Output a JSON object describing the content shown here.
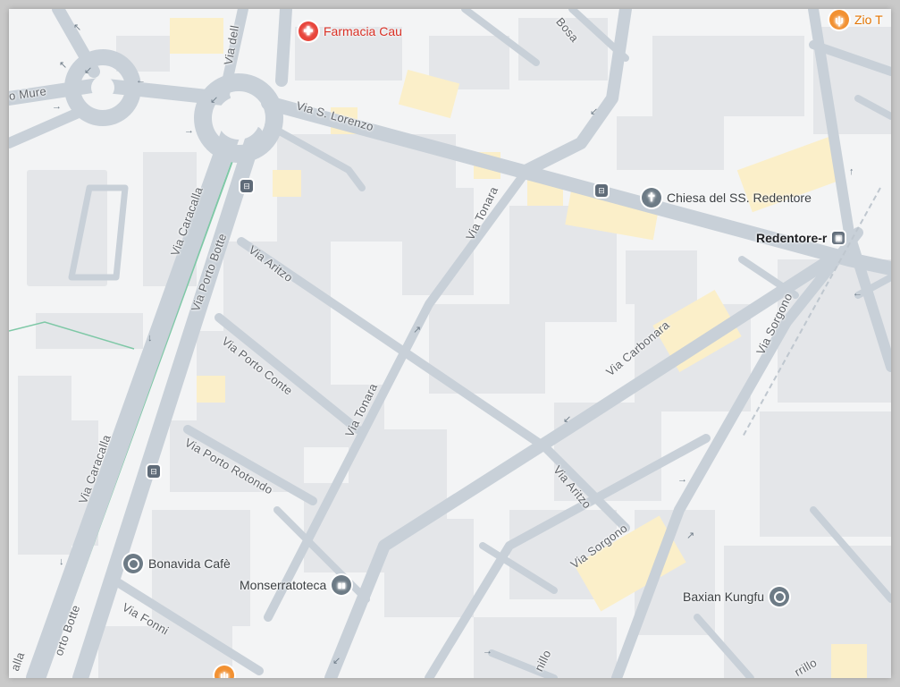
{
  "map": {
    "background": "#f3f4f5",
    "road_color": "#c8d0d8",
    "building_color": "#e4e6e9",
    "highlight_color": "#fbefc9",
    "park_path_color": "#7ec8a6"
  },
  "streets": [
    {
      "name": "Via S. Lorenzo"
    },
    {
      "name": "Via Caracalla"
    },
    {
      "name": "Via Caracalla"
    },
    {
      "name": "Via Porto Botte"
    },
    {
      "name": "Via Aritzo"
    },
    {
      "name": "Via Aritzo"
    },
    {
      "name": "Via Porto Conte"
    },
    {
      "name": "Via Tonara"
    },
    {
      "name": "Via Tonara"
    },
    {
      "name": "Via Porto Rotondo"
    },
    {
      "name": "Via Carbonara"
    },
    {
      "name": "Via Sorgono"
    },
    {
      "name": "Via Sorgono"
    },
    {
      "name": "Via Fonni"
    },
    {
      "name": "o Mure"
    },
    {
      "name": "Via dell"
    },
    {
      "name": "Bosa"
    },
    {
      "name": "orto Botte"
    },
    {
      "name": "alla"
    },
    {
      "name": "nillo"
    },
    {
      "name": "rrillo"
    }
  ],
  "pois": [
    {
      "name": "Farmacia Cau",
      "icon": "pharmacy-icon",
      "color": "#e8453c"
    },
    {
      "name": "Chiesa del SS. Redentore",
      "icon": "church-icon",
      "color": "#6d7b86"
    },
    {
      "name": "Redentore-r",
      "icon": "bus-stop-icon",
      "color": "#5b6f80"
    },
    {
      "name": "Bonavida Cafè",
      "icon": "place-icon",
      "color": "#6d7b86"
    },
    {
      "name": "Monserratoteca",
      "icon": "library-icon",
      "color": "#6d7b86"
    },
    {
      "name": "Baxian Kungfu",
      "icon": "place-icon",
      "color": "#6d7b86"
    },
    {
      "name": "Zio T",
      "icon": "restaurant-icon",
      "color": "#f29132"
    }
  ],
  "bus_symbol": "⊟",
  "pin_glyphs": {
    "pharmacy": "✚",
    "church": "✝",
    "library": "▮▮",
    "restaurant": "ψ",
    "bus": "▣"
  }
}
